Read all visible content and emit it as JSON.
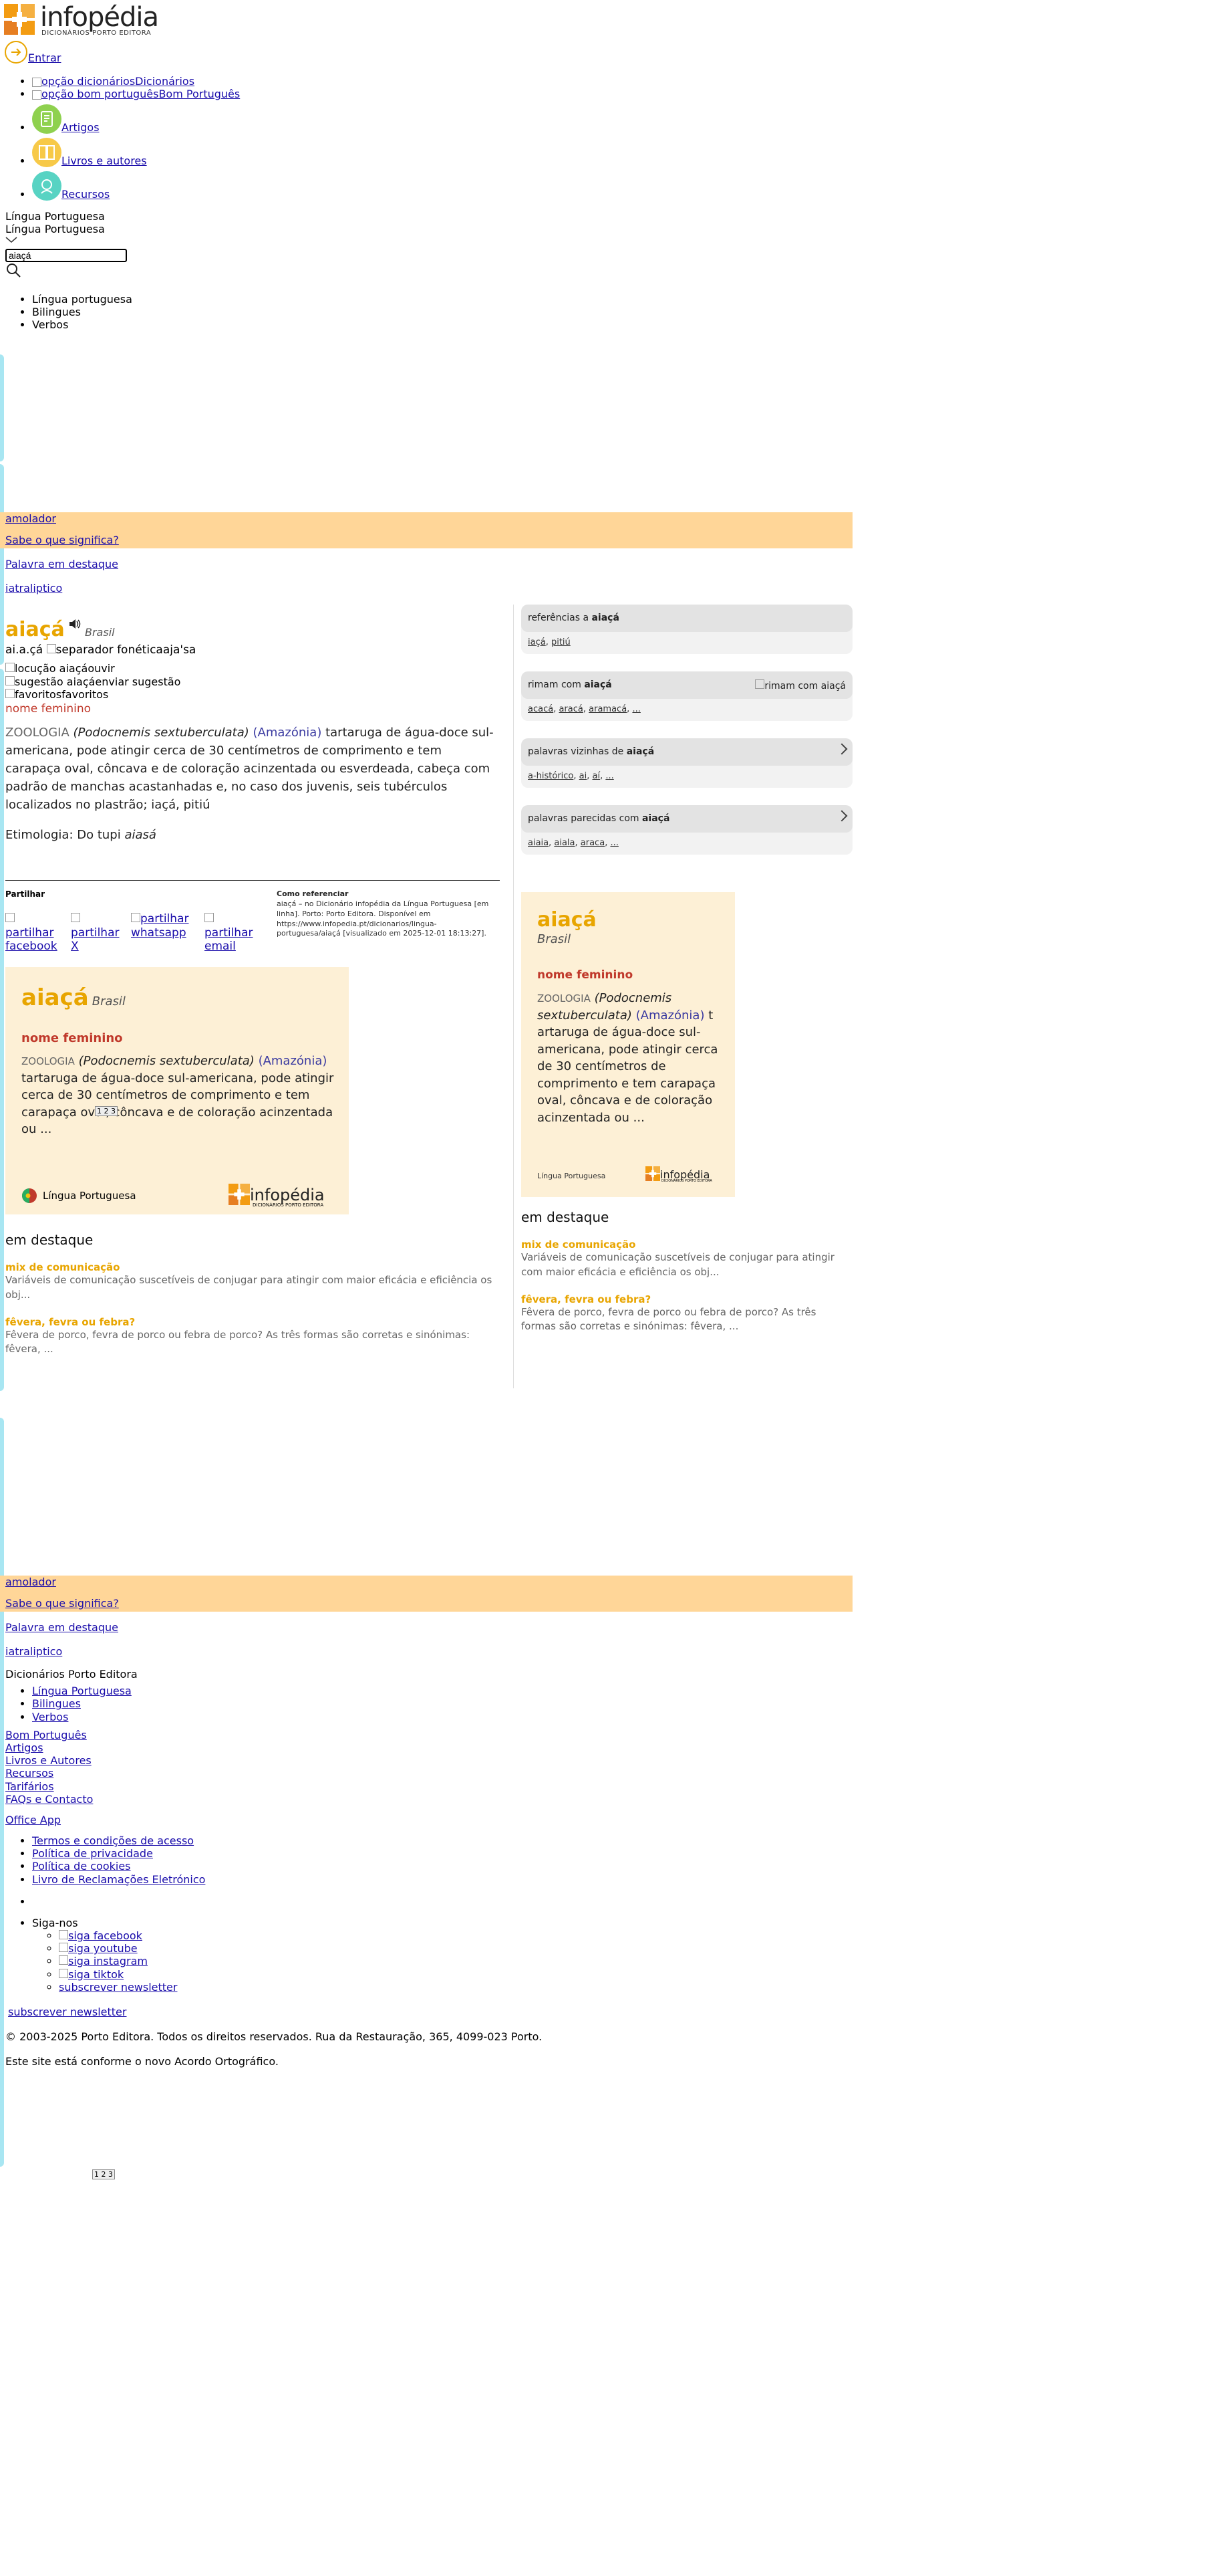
{
  "header": {
    "logo_text": "infopédia",
    "logo_sub": "DICIONÁRIOS PORTO EDITORA",
    "login_label": "Entrar"
  },
  "nav": {
    "items": [
      {
        "img_alt": "opção dicionários",
        "label": "Dicionários"
      },
      {
        "img_alt": "opção bom português",
        "label": "Bom Português"
      },
      {
        "label": "Artigos"
      },
      {
        "label": "Livros e autores"
      },
      {
        "label": "Recursos"
      }
    ],
    "colors": {
      "artigos": "#8fd14f",
      "livros": "#f7c948",
      "recursos": "#58d3c3"
    }
  },
  "search": {
    "dict_label_1": "Língua Portuguesa",
    "dict_label_2": "Língua Portuguesa",
    "value": "aiaçá",
    "dictionaries": [
      "Língua portuguesa",
      "Bilingues",
      "Verbos"
    ]
  },
  "promo": {
    "link1": "amolador",
    "link2": "Sabe o que significa?",
    "link3": "Palavra em destaque",
    "link4": "iatraliptico"
  },
  "entry": {
    "word": "aiaçá",
    "origin": "Brasil",
    "syllables": "ai.a.çá",
    "separator_alt": "separador fonética",
    "phonetic": "aja'sa",
    "locution_alt": "locução aiaçá",
    "listen_label": "ouvir",
    "suggestion_alt": "sugestão aiaçá",
    "suggestion_label": "enviar sugestão",
    "favorites_alt": "favoritos",
    "favorites_label": "favoritos",
    "pos": "nome feminino",
    "domain": "ZOOLOGIA",
    "sci_name": "(Podocnemis sextuberculata)",
    "region": "(Amazónia)",
    "definition": "tartaruga de água-doce sul-americana, pode atingir cerca de 30 centímetros de comprimento e tem carapaça oval, côncava e de coloração acinzentada ou esverdeada, cabeça com padrão de manchas acastanhadas e, no caso dos juvenis, seis tubérculos localizados no plastrão; iaçá, pitiú",
    "etymology_prefix": "Etimologia: Do tupi",
    "etymology_word": "aiasá"
  },
  "share": {
    "title": "Partilhar",
    "items": [
      "partilhar facebook",
      "partilhar X",
      "partilhar whatsapp",
      "partilhar email"
    ]
  },
  "reference": {
    "title": "Como referenciar",
    "text": "aiaçá – no Dicionário infopédia da Língua Portuguesa [em linha]. Porto: Porto Editora. Disponível em https://www.infopedia.pt/dicionarios/lingua-portuguesa/aiaçá [visualizado em 2025-12-01 18:13:27]."
  },
  "card_left": {
    "word": "aiaçá",
    "origin": "Brasil",
    "pos": "nome feminino",
    "domain": "ZOOLOGIA",
    "sci_name": "(Podocnemis sextuberculata)",
    "region": "(Amazónia)",
    "text": "tartaruga de água-doce sul-americana, pode atingir cerca de 30 centímetros de comprimento e tem carapaça oval, côncava e de coloração acinzentada ou ...",
    "flag_label": "Língua Portuguesa",
    "brand": "infopédia",
    "brand_sub": "DICIONÁRIOS PORTO EDITORA",
    "overlay": "1 2 3"
  },
  "card_right": {
    "word": "aiaçá",
    "origin": "Brasil",
    "pos": "nome feminino",
    "domain": "ZOOLOGIA",
    "sci_name": "(Podocnemis sextuberculata)",
    "region": "(Amazónia)",
    "text": "t artaruga de água-doce sul-americana, pode atingir cerca de 30 centímetros de comprimento e tem carapaça oval, côncava e de coloração acinzentada ou ...",
    "footer_label": "Língua Portuguesa",
    "brand": "infopédia",
    "brand_sub": "DICIONÁRIOS PORTO EDITORA"
  },
  "highlights": {
    "title": "em destaque",
    "items": [
      {
        "title": "mix de comunicação",
        "text": "Variáveis de comunicação suscetíveis de conjugar para atingir com maior eficácia e eficiência os obj..."
      },
      {
        "title": "fêvera, fevra ou febra?",
        "text": "Fêvera de porco, fevra de porco ou febra de porco? As três formas são corretas e sinónimas: fêvera, ..."
      }
    ]
  },
  "panels": {
    "refs": {
      "head_prefix": "referências a",
      "word": "aiaçá",
      "links": [
        "iaçá",
        "pitiú"
      ]
    },
    "rhymes": {
      "head_prefix": "rimam com",
      "word": "aiaçá",
      "img_alt": "rimam com aiaçá",
      "links": [
        "acacá",
        "aracá",
        "aramacá",
        "..."
      ]
    },
    "neighbors": {
      "head_prefix": "palavras vizinhas de",
      "word": "aiaçá",
      "links": [
        "a-histórico",
        "ai",
        "aí",
        "..."
      ]
    },
    "similar": {
      "head_prefix": "palavras parecidas com",
      "word": "aiaçá",
      "links": [
        "aiaia",
        "aiala",
        "araca",
        "..."
      ]
    }
  },
  "footer": {
    "brand_heading": "Dicionários Porto Editora",
    "dict_links": [
      "Língua Portuguesa",
      "Bilingues",
      "Verbos"
    ],
    "section_links": [
      "Bom Português",
      "Artigos",
      "Livros e Autores",
      "Recursos",
      "Tarifários",
      "FAQs e Contacto"
    ],
    "office_app": "Office App",
    "legal_links": [
      "Termos e condições de acesso",
      "Política de privacidade",
      "Política de cookies",
      "Livro de Reclamações Eletrónico"
    ],
    "follow_label": "Siga-nos",
    "social_links": [
      "siga facebook",
      "siga youtube",
      "siga instagram",
      "siga tiktok",
      "subscrever newsletter"
    ],
    "newsletter": "subscrever newsletter",
    "copyright": "© 2003-2025 Porto Editora. Todos os direitos reservados. Rua da Restauração, 365, 4099-023 Porto.",
    "agreement": "Este site está conforme o novo Acordo Ortográfico.",
    "bottom_widget": "1 2 3"
  }
}
